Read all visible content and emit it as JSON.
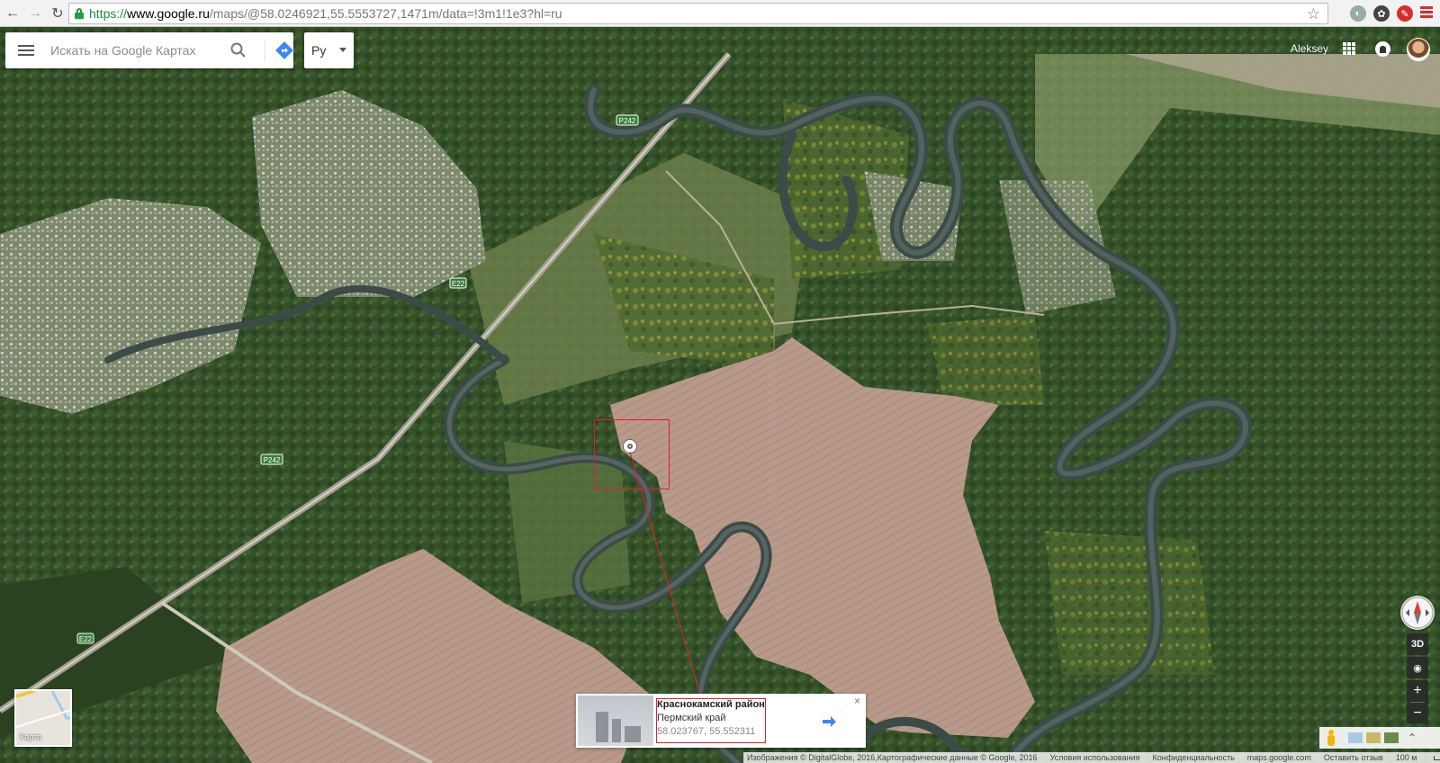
{
  "browser": {
    "url_scheme": "https://",
    "url_host": "www.google.ru",
    "url_path": "/maps/@58.0246921,55.5553727,1471m/data=!3m1!1e3?hl=ru"
  },
  "search": {
    "placeholder": "Искать на Google Картах"
  },
  "language": {
    "selected": "Ру"
  },
  "user": {
    "name": "Aleksey"
  },
  "roads": {
    "r242_top": "P242",
    "r242_bottom": "P242",
    "e22_top": "E22",
    "e22_bottom": "E22"
  },
  "info_card": {
    "title": "Краснокамский район",
    "subtitle": "Пермский край",
    "coords": "58.023767, 55.552311",
    "close": "×"
  },
  "minimap": {
    "label": "Карта"
  },
  "controls": {
    "three_d": "3D",
    "zoom_in": "+",
    "zoom_out": "−"
  },
  "footer": {
    "imagery": "Изображения © DigitalGlobe, 2016,Картографические данные © Google, 2016",
    "terms": "Условия использования",
    "privacy": "Конфиденциальность",
    "site": "maps.google.com",
    "feedback": "Оставить отзыв",
    "scale": "100 м"
  },
  "colors": {
    "accent_blue": "#4285f4",
    "highlight_red": "#e0222a",
    "river": "#3b4b4a",
    "field": "#b89886",
    "forest": "#2f4a22"
  }
}
